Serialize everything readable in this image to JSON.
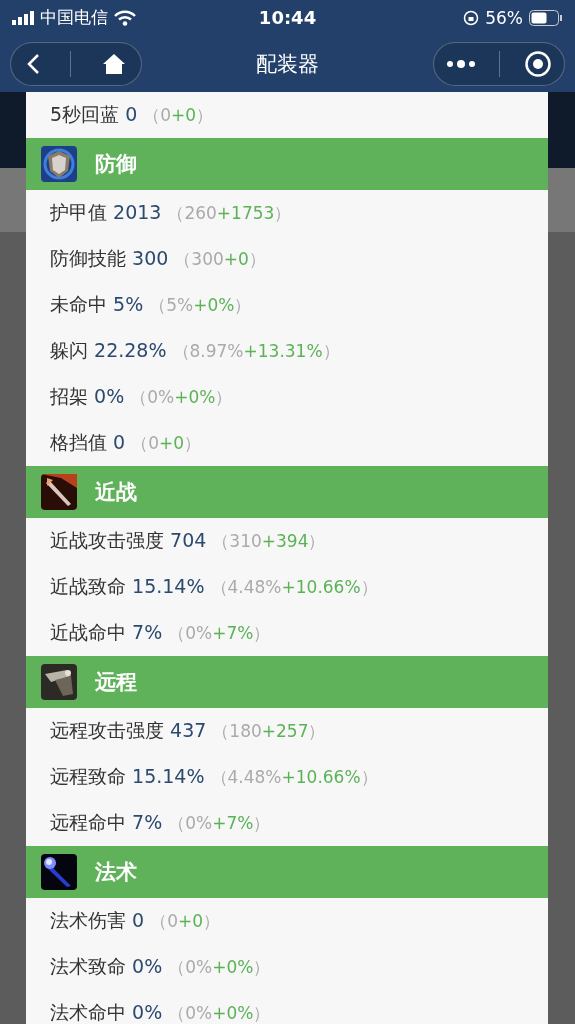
{
  "status_bar": {
    "carrier": "中国电信",
    "time": "10:44",
    "battery": "56%"
  },
  "nav_bar": {
    "title": "配装器"
  },
  "top_stats": [
    {
      "name": "5秒回蓝",
      "value": "0",
      "base": "（0",
      "bonus": "+0",
      "close": "）"
    }
  ],
  "sections": [
    {
      "title": "防御",
      "stats": [
        {
          "name": "护甲值",
          "value": "2013",
          "base": "（260",
          "bonus": "+1753",
          "close": "）"
        },
        {
          "name": "防御技能",
          "value": "300",
          "base": "（300",
          "bonus": "+0",
          "close": "）"
        },
        {
          "name": "未命中",
          "value": "5%",
          "base": "（5%",
          "bonus": "+0%",
          "close": "）"
        },
        {
          "name": "躲闪",
          "value": "22.28%",
          "base": "（8.97%",
          "bonus": "+13.31%",
          "close": "）"
        },
        {
          "name": "招架",
          "value": "0%",
          "base": "（0%",
          "bonus": "+0%",
          "close": "）"
        },
        {
          "name": "格挡值",
          "value": "0",
          "base": "（0",
          "bonus": "+0",
          "close": "）"
        }
      ]
    },
    {
      "title": "近战",
      "stats": [
        {
          "name": "近战攻击强度",
          "value": "704",
          "base": "（310",
          "bonus": "+394",
          "close": "）"
        },
        {
          "name": "近战致命",
          "value": "15.14%",
          "base": "（4.48%",
          "bonus": "+10.66%",
          "close": "）"
        },
        {
          "name": "近战命中",
          "value": "7%",
          "base": "（0%",
          "bonus": "+7%",
          "close": "）"
        }
      ]
    },
    {
      "title": "远程",
      "stats": [
        {
          "name": "远程攻击强度",
          "value": "437",
          "base": "（180",
          "bonus": "+257",
          "close": "）"
        },
        {
          "name": "远程致命",
          "value": "15.14%",
          "base": "（4.48%",
          "bonus": "+10.66%",
          "close": "）"
        },
        {
          "name": "远程命中",
          "value": "7%",
          "base": "（0%",
          "bonus": "+7%",
          "close": "）"
        }
      ]
    },
    {
      "title": "法术",
      "stats": [
        {
          "name": "法术伤害",
          "value": "0",
          "base": "（0",
          "bonus": "+0",
          "close": "）"
        },
        {
          "name": "法术致命",
          "value": "0%",
          "base": "（0%",
          "bonus": "+0%",
          "close": "）"
        },
        {
          "name": "法术命中",
          "value": "0%",
          "base": "（0%",
          "bonus": "+0%",
          "close": "）"
        }
      ]
    }
  ]
}
